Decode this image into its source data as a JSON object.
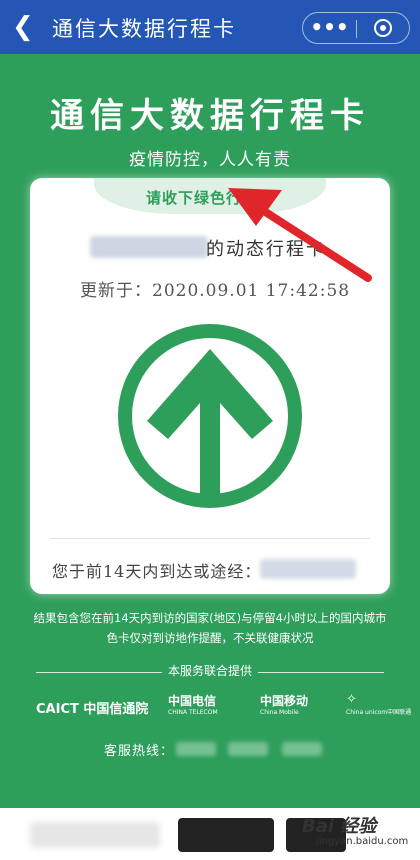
{
  "topbar": {
    "title": "通信大数据行程卡",
    "more_glyph": "•••"
  },
  "header": {
    "title": "通信大数据行程卡",
    "subtitle": "疫情防控，人人有责"
  },
  "card": {
    "tab_label": "请收下绿色行程卡",
    "phone_suffix": "的动态行程卡",
    "updated": "更新于：2020.09.01 17:42:58",
    "status_color": "#2e9e5b",
    "route_label": "您于前14天内到达或途经："
  },
  "notice": {
    "line1": "结果包含您在前14天内到访的国家(地区)与停留4小时以上的国内城市",
    "line2": "色卡仅对到访地作提醒，不关联健康状况"
  },
  "providers": {
    "label": "本服务联合提供",
    "caict": "CAICT 中国信通院",
    "telecom_cn": "中国电信",
    "telecom_en": "CHINA TELECOM",
    "mobile_cn": "中国移动",
    "mobile_en": "China Mobile",
    "unicom_en": "China unicom中国联通"
  },
  "hotline": {
    "label": "客服热线："
  },
  "watermark": {
    "main": "Bai 经验",
    "sub": "jingyan.baidu.com"
  }
}
